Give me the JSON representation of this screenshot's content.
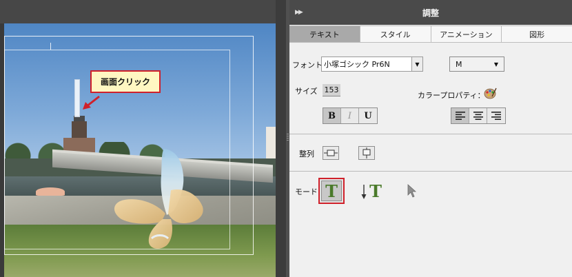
{
  "canvas": {
    "callout_text": "画面クリック"
  },
  "panel": {
    "title": "調整",
    "tabs": [
      {
        "label": "テキスト",
        "active": true
      },
      {
        "label": "スタイル",
        "active": false
      },
      {
        "label": "アニメーション",
        "active": false
      },
      {
        "label": "図形",
        "active": false
      }
    ],
    "font_label": "フォント",
    "font_value": "小塚ゴシック Pr6N",
    "style_value": "M",
    "size_label": "サイズ",
    "size_value": "153",
    "color_label": "カラープロパティ：",
    "format_buttons": {
      "bold": "B",
      "italic": "I",
      "underline": "U"
    },
    "align_label": "整列",
    "mode_label": "モード",
    "mode_glyph": "T",
    "colors": {
      "accent_red": "#d0202a",
      "tab_active": "#a9a9a9",
      "header": "#4a4a4a",
      "mode_green": "#4a7a2a"
    }
  },
  "icons": [
    "collapse-icon",
    "dropdown-arrow-icon",
    "palette-icon",
    "align-left-icon",
    "align-center-icon",
    "align-right-icon",
    "align-vertical-center-icon",
    "align-horizontal-center-icon",
    "horizontal-text-icon",
    "vertical-text-icon",
    "selection-tool-icon"
  ]
}
